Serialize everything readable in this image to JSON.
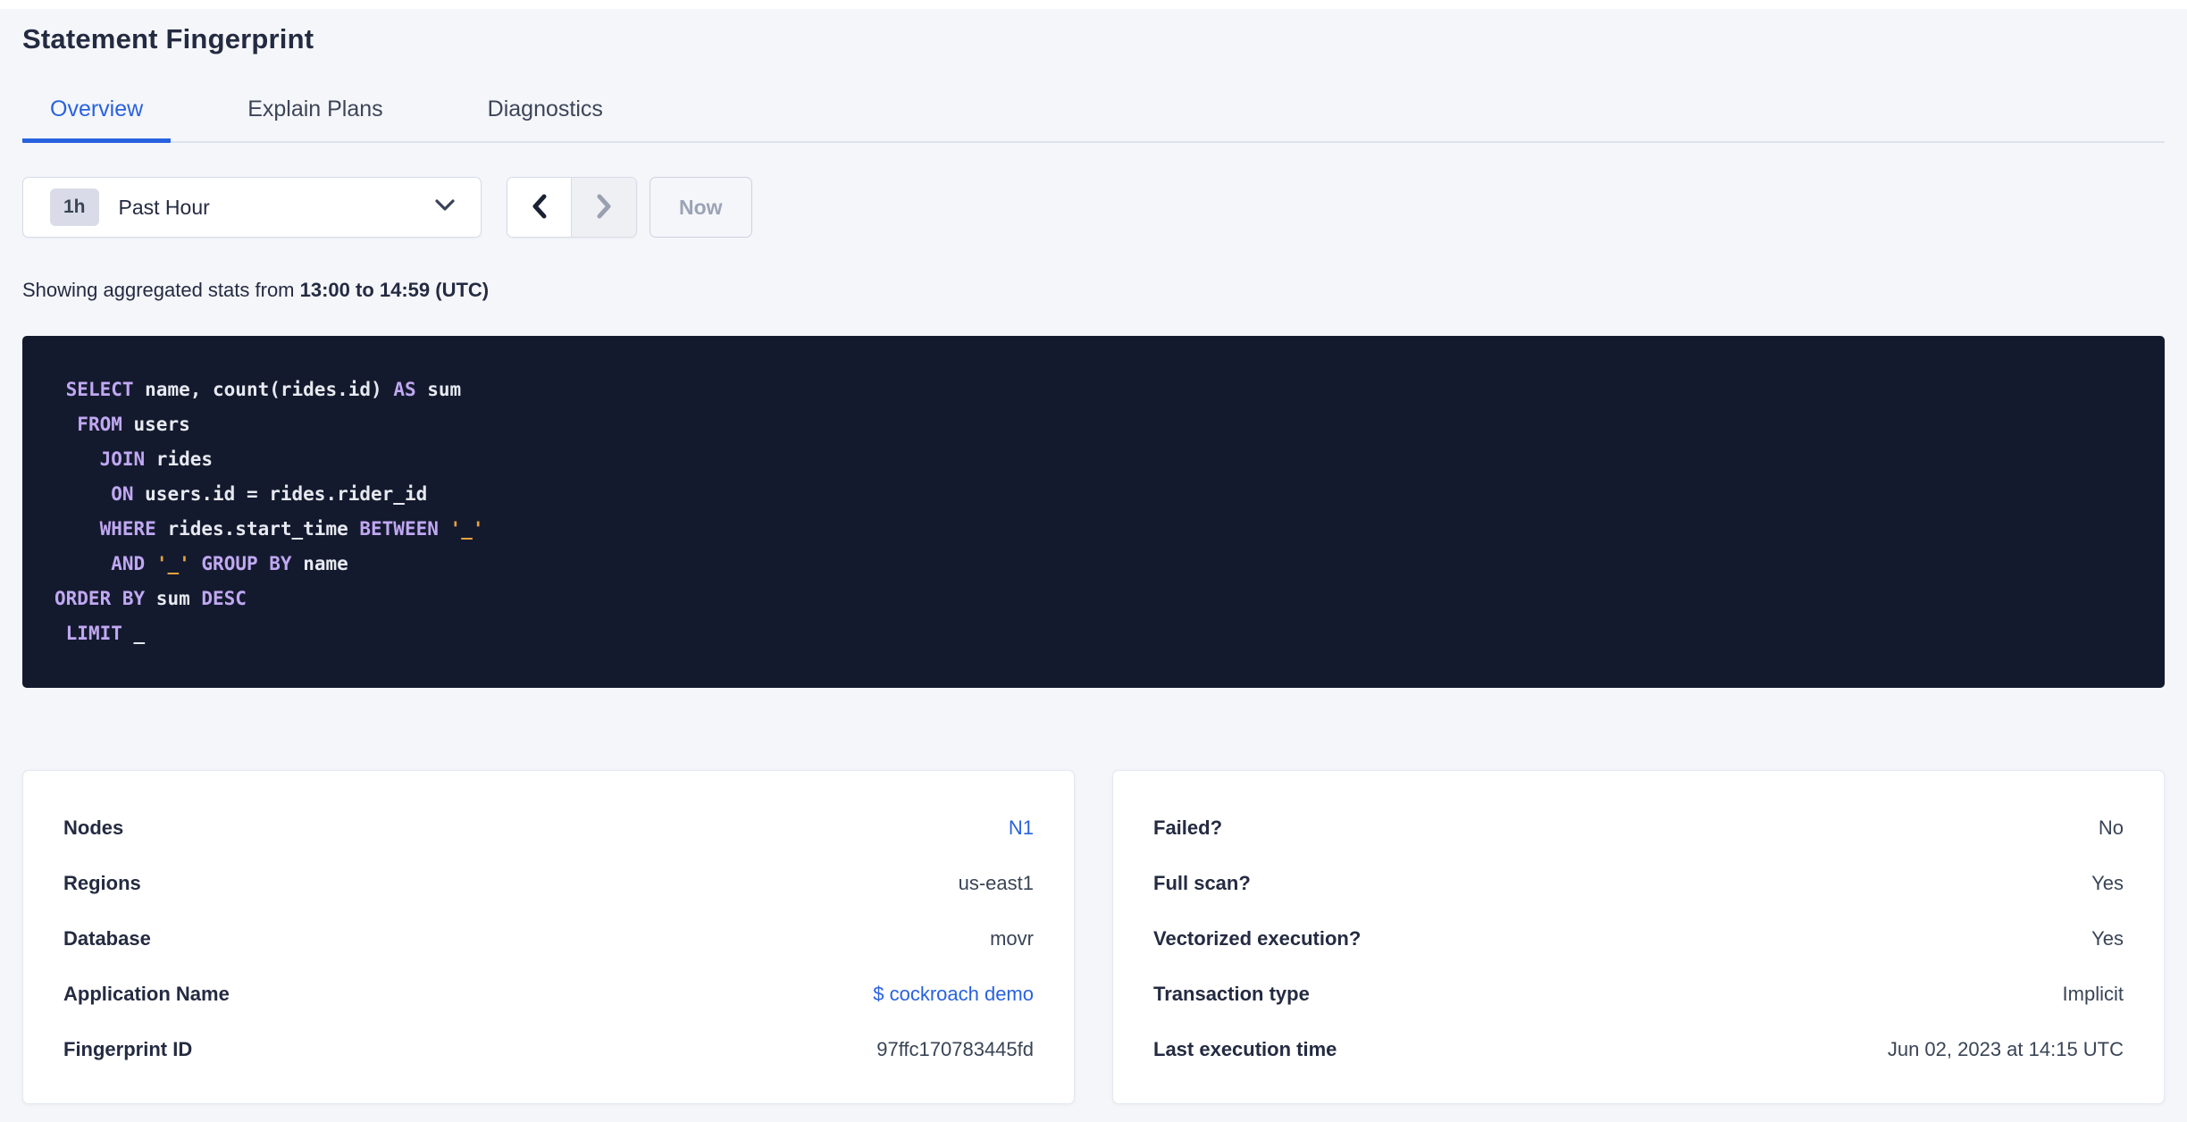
{
  "page": {
    "title": "Statement Fingerprint"
  },
  "colors": {
    "accent_blue": "#2962e0",
    "page_background": "#f5f6fa",
    "sql_background": "#141a2e",
    "sql_keyword": "#c0a8f2",
    "sql_literal": "#e8a33c",
    "sql_text": "#e7e9f0"
  },
  "tabs": [
    {
      "label": "Overview",
      "active": true
    },
    {
      "label": "Explain Plans",
      "active": false
    },
    {
      "label": "Diagnostics",
      "active": false
    }
  ],
  "toolbar": {
    "range_badge": "1h",
    "range_label": "Past Hour",
    "now_label": "Now",
    "icons": [
      "chevron-down-icon",
      "chevron-left-icon",
      "chevron-right-icon"
    ]
  },
  "summary": {
    "prefix": "Showing aggregated stats from ",
    "range": "13:00 to 14:59 (UTC)"
  },
  "sql": {
    "lines": [
      [
        {
          "t": " "
        },
        {
          "t": "SELECT",
          "k": "kw"
        },
        {
          "t": " name, count(rides.id) "
        },
        {
          "t": "AS",
          "k": "kw"
        },
        {
          "t": " sum"
        }
      ],
      [
        {
          "t": "  "
        },
        {
          "t": "FROM",
          "k": "kw"
        },
        {
          "t": " users"
        }
      ],
      [
        {
          "t": "    "
        },
        {
          "t": "JOIN",
          "k": "kw"
        },
        {
          "t": " rides"
        }
      ],
      [
        {
          "t": "     "
        },
        {
          "t": "ON",
          "k": "kw"
        },
        {
          "t": " users.id = rides.rider_id"
        }
      ],
      [
        {
          "t": "    "
        },
        {
          "t": "WHERE",
          "k": "kw"
        },
        {
          "t": " rides.start_time "
        },
        {
          "t": "BETWEEN",
          "k": "kw"
        },
        {
          "t": " "
        },
        {
          "t": "'_'",
          "k": "lit"
        }
      ],
      [
        {
          "t": "     "
        },
        {
          "t": "AND",
          "k": "kw"
        },
        {
          "t": " "
        },
        {
          "t": "'_'",
          "k": "lit"
        },
        {
          "t": " "
        },
        {
          "t": "GROUP BY",
          "k": "kw"
        },
        {
          "t": " name"
        }
      ],
      [
        {
          "t": "ORDER BY",
          "k": "kw"
        },
        {
          "t": " sum "
        },
        {
          "t": "DESC",
          "k": "kw"
        }
      ],
      [
        {
          "t": " "
        },
        {
          "t": "LIMIT",
          "k": "kw"
        },
        {
          "t": " _"
        }
      ]
    ]
  },
  "cards": {
    "left": {
      "rows": [
        {
          "label": "Nodes",
          "value": "N1",
          "link": true
        },
        {
          "label": "Regions",
          "value": "us-east1",
          "link": false
        },
        {
          "label": "Database",
          "value": "movr",
          "link": false
        },
        {
          "label": "Application Name",
          "value": "$ cockroach demo",
          "link": true
        },
        {
          "label": "Fingerprint ID",
          "value": "97ffc170783445fd",
          "link": false
        }
      ]
    },
    "right": {
      "rows": [
        {
          "label": "Failed?",
          "value": "No",
          "link": false
        },
        {
          "label": "Full scan?",
          "value": "Yes",
          "link": false
        },
        {
          "label": "Vectorized execution?",
          "value": "Yes",
          "link": false
        },
        {
          "label": "Transaction type",
          "value": "Implicit",
          "link": false
        },
        {
          "label": "Last execution time",
          "value": "Jun 02, 2023 at 14:15 UTC",
          "link": false
        }
      ]
    }
  }
}
